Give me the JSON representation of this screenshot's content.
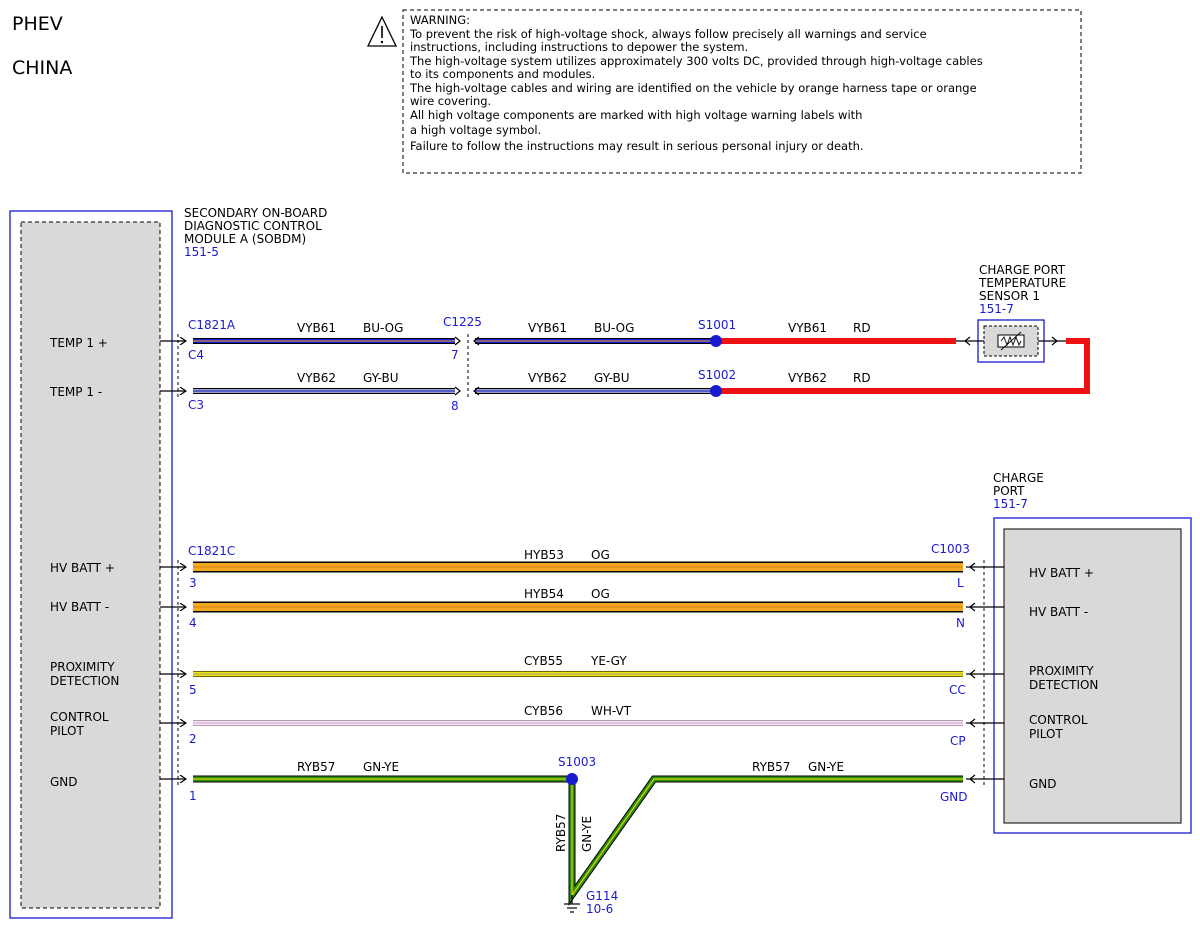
{
  "header": {
    "line1": "PHEV",
    "line2": "CHINA"
  },
  "warning": {
    "lines": [
      "WARNING:",
      "To prevent the risk of high-voltage shock, always follow precisely all warnings and service",
      "instructions, including instructions to depower the system.",
      "The high-voltage system utilizes approximately 300 volts DC, provided through high-voltage cables",
      "to its components and modules.",
      "The high-voltage cables and wiring are identified on the vehicle by orange harness tape or orange",
      "wire covering.",
      "All high voltage components are marked with high voltage warning labels with",
      "a high voltage symbol.",
      "Failure to follow the instructions may result in serious personal injury or death."
    ]
  },
  "module_a": {
    "name_lines": [
      "SECONDARY ON-BOARD",
      "DIAGNOSTIC CONTROL",
      "MODULE A (SOBDM)"
    ],
    "ref": "151-5",
    "pins": [
      {
        "lines": [
          "TEMP 1 +"
        ]
      },
      {
        "lines": [
          "TEMP 1 -"
        ]
      },
      {
        "lines": [
          "HV BATT +"
        ]
      },
      {
        "lines": [
          "HV BATT -"
        ]
      },
      {
        "lines": [
          "PROXIMITY",
          "DETECTION"
        ]
      },
      {
        "lines": [
          "CONTROL",
          "PILOT"
        ]
      },
      {
        "lines": [
          "GND"
        ]
      }
    ]
  },
  "sensor": {
    "name_lines": [
      "CHARGE PORT",
      "TEMPERATURE",
      "SENSOR 1"
    ],
    "ref": "151-7"
  },
  "charge_port": {
    "name_lines": [
      "CHARGE",
      "PORT"
    ],
    "ref": "151-7",
    "pins": [
      {
        "lines": [
          "HV BATT +"
        ]
      },
      {
        "lines": [
          "HV BATT -"
        ]
      },
      {
        "lines": [
          "PROXIMITY",
          "DETECTION"
        ]
      },
      {
        "lines": [
          "CONTROL",
          "PILOT"
        ]
      },
      {
        "lines": [
          "GND"
        ]
      }
    ]
  },
  "connectors": {
    "c1821a": "C1821A",
    "c1821a_pin1": "C4",
    "c1821a_pin2": "C3",
    "c1225": "C1225",
    "c1225_pin1": "7",
    "c1225_pin2": "8",
    "c1821c": "C1821C",
    "c1821c_pins": [
      "3",
      "4",
      "5",
      "2",
      "1"
    ],
    "c1003": "C1003",
    "c1003_pins": [
      "L",
      "N",
      "CC",
      "CP",
      "GND"
    ]
  },
  "splices": {
    "s1001": "S1001",
    "s1002": "S1002",
    "s1003": "S1003"
  },
  "ground": {
    "name": "G114",
    "ref": "10-6"
  },
  "wires": {
    "temp_plus": {
      "circuit": "VYB61",
      "color1": "BU-OG",
      "color2": "RD"
    },
    "temp_minus": {
      "circuit": "VYB62",
      "color1": "GY-BU",
      "color2": "RD"
    },
    "hv_plus": {
      "circuit": "HYB53",
      "color": "OG"
    },
    "hv_minus": {
      "circuit": "HYB54",
      "color": "OG"
    },
    "proximity": {
      "circuit": "CYB55",
      "color": "YE-GY"
    },
    "pilot": {
      "circuit": "CYB56",
      "color": "WH-VT"
    },
    "gnd": {
      "circuit": "RYB57",
      "color": "GN-YE"
    }
  },
  "colors": {
    "blue": "#1a1ad0",
    "red": "#ee1111",
    "orange": "#f5a623",
    "yellow": "#f2e600",
    "green": "#2f8f12",
    "pink": "#e8c6e2"
  }
}
